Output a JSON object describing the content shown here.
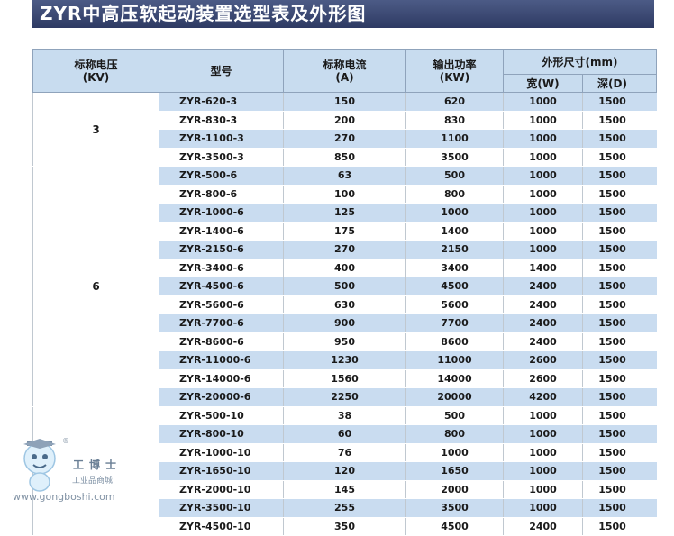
{
  "title": "ZYR中高压软起动装置选型表及外形图",
  "header": {
    "voltage": "标称电压\n(KV)",
    "model": "型号",
    "current": "标称电流\n(A)",
    "power": "输出功率\n(KW)",
    "dimensions": "外形尺寸(mm)",
    "width": "宽(W)",
    "depth": "深(D)"
  },
  "groups": [
    {
      "voltage": "3",
      "rows": [
        [
          "ZYR-620-3",
          "150",
          "620",
          "1000",
          "1500"
        ],
        [
          "ZYR-830-3",
          "200",
          "830",
          "1000",
          "1500"
        ],
        [
          "ZYR-1100-3",
          "270",
          "1100",
          "1000",
          "1500"
        ],
        [
          "ZYR-3500-3",
          "850",
          "3500",
          "1000",
          "1500"
        ]
      ]
    },
    {
      "voltage": "6",
      "rows": [
        [
          "ZYR-500-6",
          "63",
          "500",
          "1000",
          "1500"
        ],
        [
          "ZYR-800-6",
          "100",
          "800",
          "1000",
          "1500"
        ],
        [
          "ZYR-1000-6",
          "125",
          "1000",
          "1000",
          "1500"
        ],
        [
          "ZYR-1400-6",
          "175",
          "1400",
          "1000",
          "1500"
        ],
        [
          "ZYR-2150-6",
          "270",
          "2150",
          "1000",
          "1500"
        ],
        [
          "ZYR-3400-6",
          "400",
          "3400",
          "1400",
          "1500"
        ],
        [
          "ZYR-4500-6",
          "500",
          "4500",
          "2400",
          "1500"
        ],
        [
          "ZYR-5600-6",
          "630",
          "5600",
          "2400",
          "1500"
        ],
        [
          "ZYR-7700-6",
          "900",
          "7700",
          "2400",
          "1500"
        ],
        [
          "ZYR-8600-6",
          "950",
          "8600",
          "2400",
          "1500"
        ],
        [
          "ZYR-11000-6",
          "1230",
          "11000",
          "2600",
          "1500"
        ],
        [
          "ZYR-14000-6",
          "1560",
          "14000",
          "2600",
          "1500"
        ],
        [
          "ZYR-20000-6",
          "2250",
          "20000",
          "4200",
          "1500"
        ]
      ]
    },
    {
      "voltage": "",
      "rows": [
        [
          "ZYR-500-10",
          "38",
          "500",
          "1000",
          "1500"
        ],
        [
          "ZYR-800-10",
          "60",
          "800",
          "1000",
          "1500"
        ],
        [
          "ZYR-1000-10",
          "76",
          "1000",
          "1000",
          "1500"
        ],
        [
          "ZYR-1650-10",
          "120",
          "1650",
          "1000",
          "1500"
        ],
        [
          "ZYR-2000-10",
          "145",
          "2000",
          "1000",
          "1500"
        ],
        [
          "ZYR-3500-10",
          "255",
          "3500",
          "1000",
          "1500"
        ],
        [
          "ZYR-4500-10",
          "350",
          "4500",
          "2400",
          "1500"
        ]
      ]
    }
  ],
  "watermark": {
    "brand": "工博士",
    "subtitle": "工业品商城",
    "url": "www.gongboshi.com",
    "registered": "®"
  },
  "colors": {
    "title_bar": "#3a4670",
    "header_bg": "#c8dcef",
    "stripe": "#c9dcf0"
  }
}
